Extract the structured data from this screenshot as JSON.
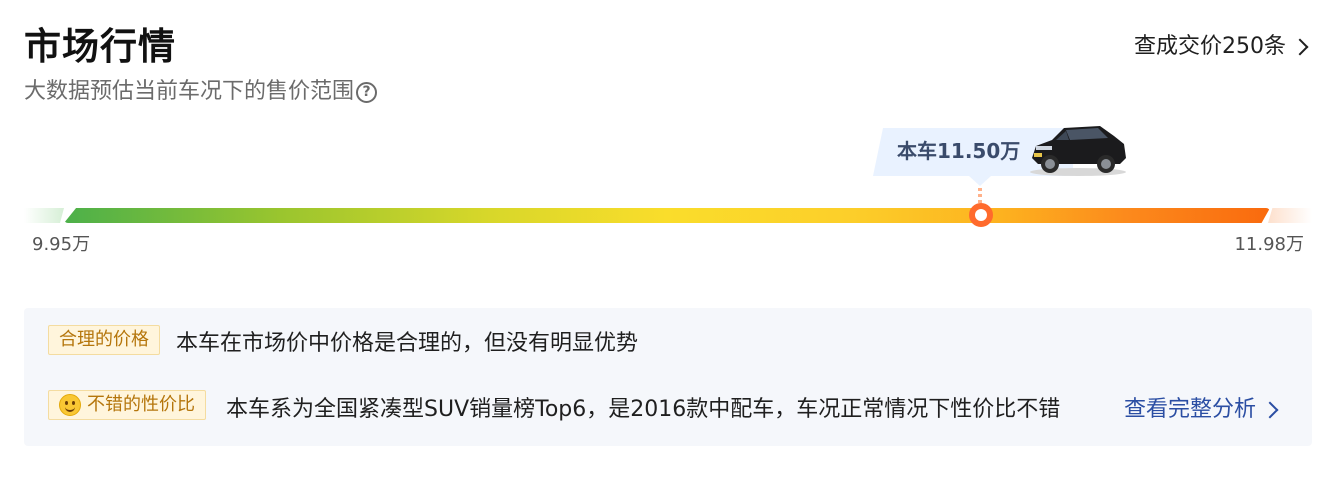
{
  "header": {
    "title": "市场行情",
    "subtitle": "大数据预估当前车况下的售价范围",
    "help_icon": "?",
    "deal_link": "查成交价250条"
  },
  "price_range": {
    "min_label": "9.95万",
    "max_label": "11.98万",
    "min_value": 9.95,
    "max_value": 11.98,
    "current_value": 11.5,
    "current_label": "本车11.50万"
  },
  "colors": {
    "green": "#4cb04a",
    "yellow": "#fadd2b",
    "orange": "#f96a0e",
    "marker": "#ff6a2c",
    "bubble_bg": "#e9f2ff",
    "tag_bg": "#fff5dc",
    "tag_text": "#b5760c",
    "link": "#2b4ea3"
  },
  "analysis": {
    "tag1": "合理的价格",
    "text1": "本车在市场价中价格是合理的，但没有明显优势",
    "tag2_icon": "smile-icon",
    "tag2": "不错的性价比",
    "text2": "本车系为全国紧凑型SUV销量榜Top6，是2016款中配车，车况正常情况下性价比不错",
    "link": "查看完整分析"
  }
}
